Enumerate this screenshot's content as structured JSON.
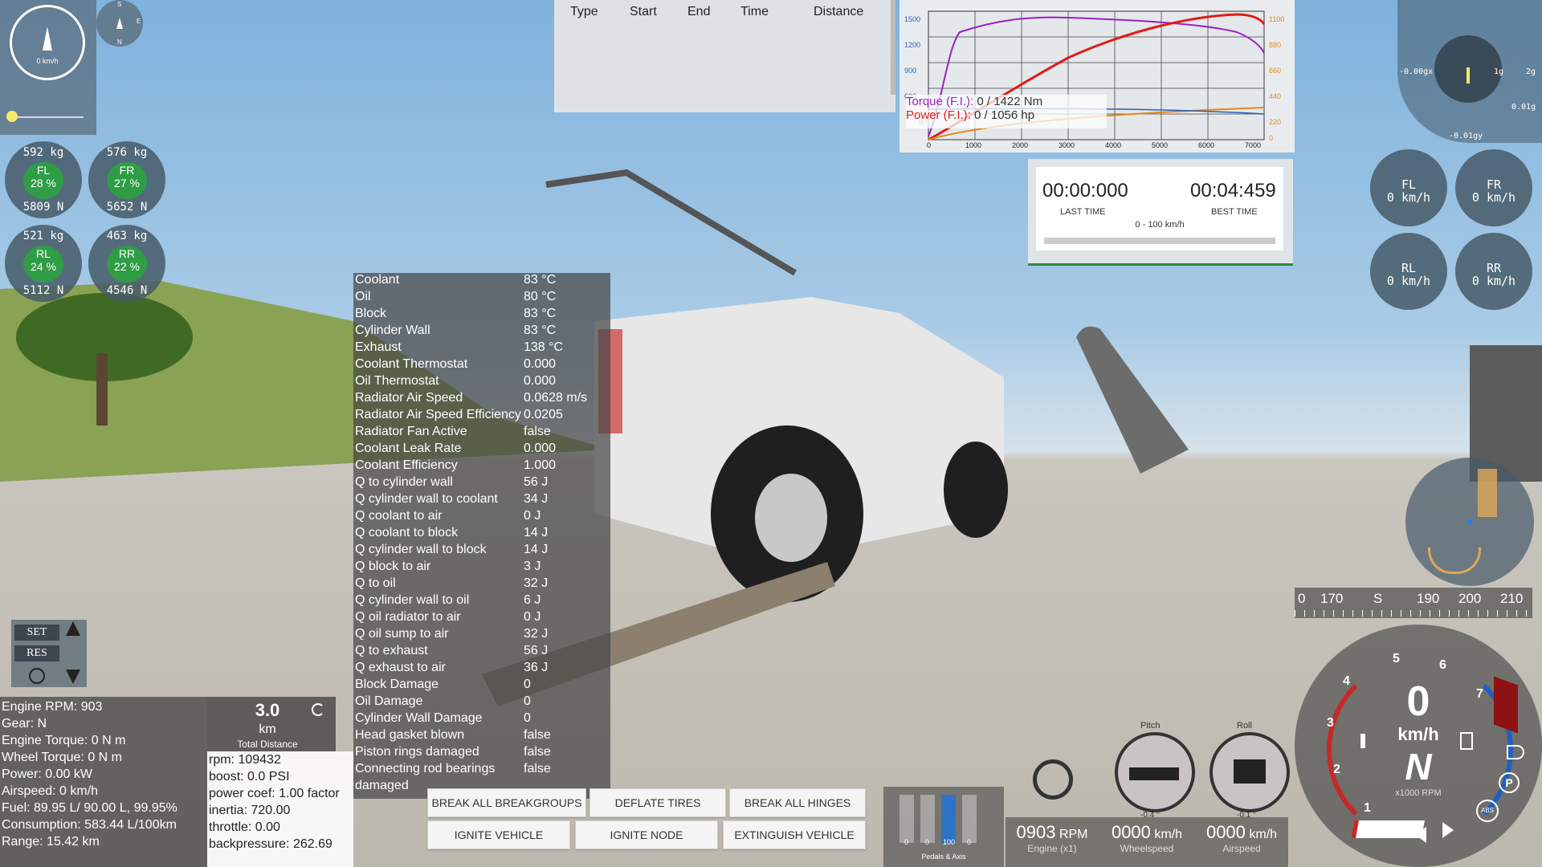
{
  "speedometer_small": {
    "label": "0 km/h",
    "compass_s": "S",
    "compass_n": "N",
    "compass_e": "E"
  },
  "wheel_loads": [
    {
      "id": "FL",
      "kg": "592 kg",
      "pct": "28 %",
      "n": "5809 N"
    },
    {
      "id": "FR",
      "kg": "576 kg",
      "pct": "27 %",
      "n": "5652 N"
    },
    {
      "id": "RL",
      "kg": "521 kg",
      "pct": "24 %",
      "n": "5112 N"
    },
    {
      "id": "RR",
      "kg": "463 kg",
      "pct": "22 %",
      "n": "4546 N"
    }
  ],
  "drag_table": {
    "headers": [
      "Type",
      "Start",
      "End",
      "Time",
      "Distance"
    ]
  },
  "dyno_graph": {
    "torque_label": "Torque (F.I.):",
    "torque_value": "0 / 1422 Nm",
    "power_label": "Power (F.I.):",
    "power_value": "0 / 1056 hp",
    "left_ticks": [
      "1500",
      "1200",
      "900",
      "600",
      "0"
    ],
    "right_ticks": [
      "1100",
      "880",
      "660",
      "440",
      "220",
      "0"
    ],
    "x_ticks": [
      "0",
      "1000",
      "2000",
      "3000",
      "4000",
      "5000",
      "6000",
      "7000"
    ],
    "colors": {
      "torque": "#9b1fc4",
      "power": "#e01b1b",
      "axis_right": "#e08a1a"
    }
  },
  "timer": {
    "last_time": "00:00:000",
    "last_label": "LAST TIME",
    "best_time": "00:04:459",
    "best_label": "BEST TIME",
    "mode": "0 - 100 km/h"
  },
  "wheel_speeds": [
    {
      "id": "FL",
      "speed": "0 km/h"
    },
    {
      "id": "FR",
      "speed": "0 km/h"
    },
    {
      "id": "RL",
      "speed": "0 km/h"
    },
    {
      "id": "RR",
      "speed": "0 km/h"
    }
  ],
  "gforce": {
    "x": "-0.00gx",
    "y_top": "0.01g",
    "y_bottom": "-0.01gy",
    "t1": "1g",
    "t2": "2g"
  },
  "thermal": [
    {
      "k": "Coolant",
      "v": "83 °C"
    },
    {
      "k": "Oil",
      "v": "80 °C"
    },
    {
      "k": "Block",
      "v": "83 °C"
    },
    {
      "k": "Cylinder Wall",
      "v": "83 °C"
    },
    {
      "k": "Exhaust",
      "v": "138 °C"
    },
    {
      "k": "Coolant Thermostat",
      "v": "0.000"
    },
    {
      "k": "Oil Thermostat",
      "v": "0.000"
    },
    {
      "k": "Radiator Air Speed",
      "v": "0.0628 m/s"
    },
    {
      "k": "Radiator Air Speed Efficiency",
      "v": "0.0205"
    },
    {
      "k": "Radiator Fan Active",
      "v": "false"
    },
    {
      "k": "Coolant Leak Rate",
      "v": "0.000"
    },
    {
      "k": "Coolant Efficiency",
      "v": "1.000"
    },
    {
      "k": "Q to cylinder wall",
      "v": "56 J"
    },
    {
      "k": "Q cylinder wall to coolant",
      "v": "34 J"
    },
    {
      "k": "Q coolant to air",
      "v": "0 J"
    },
    {
      "k": "Q coolant to block",
      "v": "14 J"
    },
    {
      "k": "Q cylinder wall to block",
      "v": "14 J"
    },
    {
      "k": "Q block to air",
      "v": "3 J"
    },
    {
      "k": "Q to oil",
      "v": "32 J"
    },
    {
      "k": "Q cylinder wall to oil",
      "v": "6 J"
    },
    {
      "k": "Q oil radiator to air",
      "v": "0 J"
    },
    {
      "k": "Q oil sump to air",
      "v": "32 J"
    },
    {
      "k": "Q to exhaust",
      "v": "56 J"
    },
    {
      "k": "Q exhaust to air",
      "v": "36 J"
    },
    {
      "k": "Block Damage",
      "v": "0"
    },
    {
      "k": "Oil Damage",
      "v": "0"
    },
    {
      "k": "Cylinder Wall Damage",
      "v": "0"
    },
    {
      "k": "Head gasket blown",
      "v": "false"
    },
    {
      "k": "Piston rings damaged",
      "v": "false"
    },
    {
      "k": "Connecting rod bearings",
      "v": "false"
    },
    {
      "k": "damaged",
      "v": ""
    }
  ],
  "cruise": {
    "set": "SET",
    "res": "RES"
  },
  "vehicle_info": [
    "Engine RPM: 903",
    "Gear: N",
    "Engine Torque: 0 N m",
    "Wheel Torque: 0 N m",
    "Power: 0.00 kW",
    "Airspeed: 0 km/h",
    "Fuel: 89.95 L/ 90.00 L, 99.95%",
    "Consumption: 583.44 L/100km",
    "Range: 15.42 km"
  ],
  "total_distance": {
    "value": "3.0",
    "unit": "km",
    "label": "Total Distance"
  },
  "forced_induction": [
    "rpm: 109432",
    "boost: 0.0 PSI",
    "power coef: 1.00 factor",
    "inertia: 720.00",
    "throttle: 0.00",
    "backpressure: 262.69"
  ],
  "actions_row1": [
    "BREAK ALL BREAKGROUPS",
    "DEFLATE TIRES",
    "BREAK ALL HINGES"
  ],
  "actions_row2": [
    "IGNITE VEHICLE",
    "IGNITE NODE",
    "EXTINGUISH VEHICLE"
  ],
  "pedals": {
    "labels": [
      "0",
      "0",
      "100",
      "0"
    ],
    "title": "Pedals & Axis"
  },
  "readouts": [
    {
      "value": "0903",
      "unit": "RPM",
      "label": "Engine (x1)"
    },
    {
      "value": "0000",
      "unit": "km/h",
      "label": "Wheelspeed"
    },
    {
      "value": "0000",
      "unit": "km/h",
      "label": "Airspeed"
    }
  ],
  "attitude": {
    "pitch_label": "Pitch",
    "pitch_value": "-0.4 °",
    "roll_label": "Roll",
    "roll_value": "-0.1 °"
  },
  "heading_tape": {
    "ticks": [
      "0",
      "170",
      "S",
      "190",
      "200",
      "210"
    ]
  },
  "big_speedo": {
    "speed": "0",
    "unit": "km/h",
    "gear": "N",
    "rpm_label": "x1000 RPM",
    "rpm_ticks": [
      "1",
      "2",
      "3",
      "4",
      "5",
      "6",
      "7"
    ],
    "abs": "ABS"
  }
}
